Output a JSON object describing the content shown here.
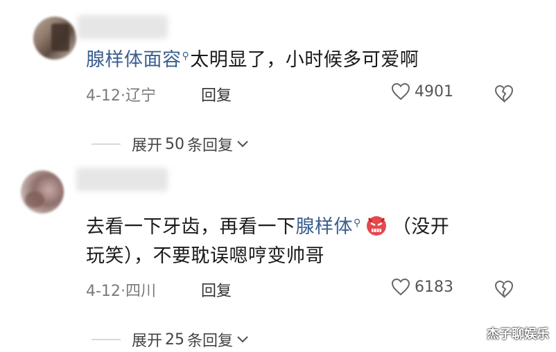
{
  "comments": [
    {
      "mention": "腺样体面容",
      "text": "太明显了，小时候多可爱啊",
      "date": "4-12",
      "sep": "·",
      "location": "辽宁",
      "reply_label": "回复",
      "likes": "4901",
      "expand_label": "展开",
      "expand_count": "50",
      "expand_suffix": "条回复"
    },
    {
      "text_before": "去看一下牙齿，再看一下",
      "mention": "腺样体",
      "text_after_line1": "（没开",
      "text_line2": "玩笑），不要耽误嗯哼变帅哥",
      "date": "4-12",
      "sep": "·",
      "location": "四川",
      "reply_label": "回复",
      "likes": "6183",
      "expand_label": "展开",
      "expand_count": "25",
      "expand_suffix": "条回复"
    }
  ],
  "watermark": "杰子聊娱乐",
  "icons": {
    "like": "heart-outline-icon",
    "dislike": "broken-heart-icon",
    "expand": "chevron-down-icon",
    "mention": "search-icon",
    "emoji": "angry-face-emoji"
  },
  "colors": {
    "mention": "#3a5f8f",
    "meta": "#7a7a7a"
  }
}
